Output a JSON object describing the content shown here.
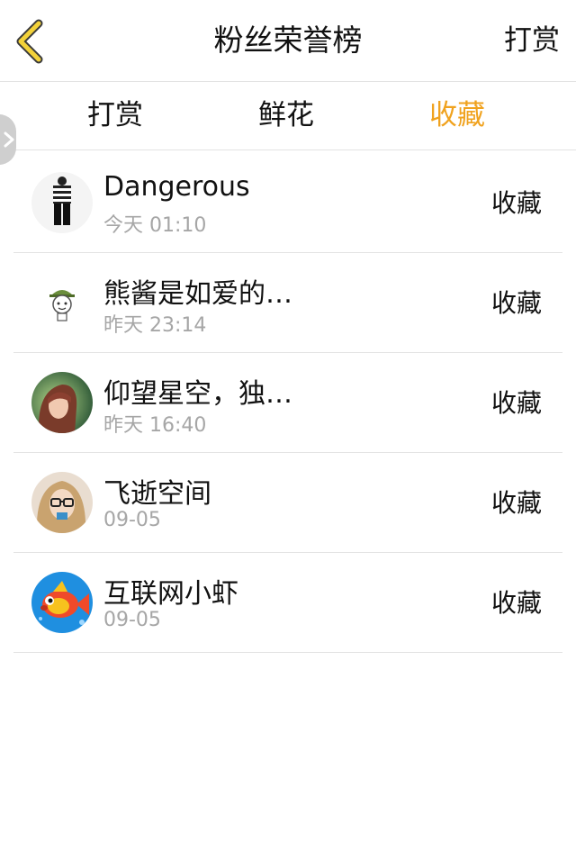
{
  "header": {
    "title": "粉丝荣誉榜",
    "back_icon": "chevron-left-icon",
    "action_label": "打赏",
    "accent_color": "#f0a21e"
  },
  "tabs": [
    {
      "label": "打赏",
      "active": false
    },
    {
      "label": "鲜花",
      "active": false
    },
    {
      "label": "收藏",
      "active": true
    }
  ],
  "list": {
    "items": [
      {
        "name": "Dangerous",
        "time": "今天 01:10",
        "action": "收藏",
        "avatar": "striped-outfit-avatar"
      },
      {
        "name": "熊酱是如爱的…",
        "time": "昨天 23:14",
        "action": "收藏",
        "avatar": "cartoon-hat-avatar"
      },
      {
        "name": "仰望星空，独…",
        "time": "昨天 16:40",
        "action": "收藏",
        "avatar": "girl-green-avatar"
      },
      {
        "name": "飞逝空间",
        "time": "09-05",
        "action": "收藏",
        "avatar": "glasses-girl-avatar"
      },
      {
        "name": "互联网小虾",
        "time": "09-05",
        "action": "收藏",
        "avatar": "cartoon-fish-avatar"
      }
    ]
  }
}
